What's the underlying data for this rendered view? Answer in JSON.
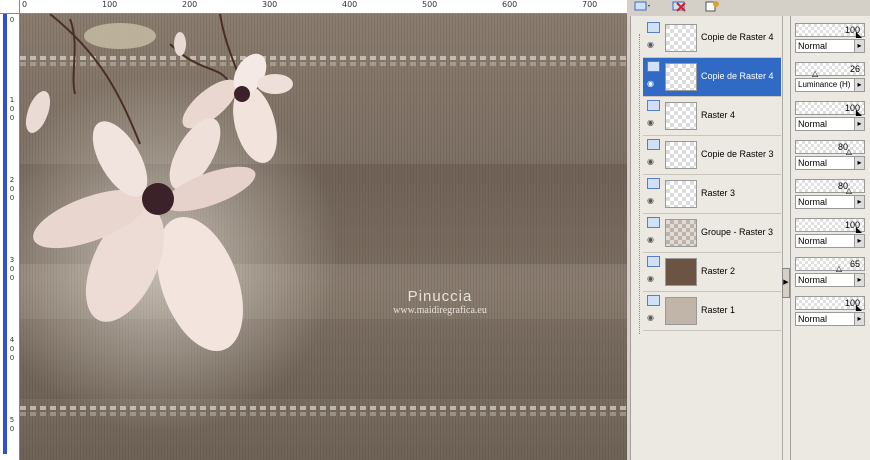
{
  "ruler": {
    "top_labels": [
      "0",
      "100",
      "200",
      "300",
      "400",
      "500",
      "600",
      "700"
    ],
    "left_labels": [
      "0",
      "1\n0\n0",
      "2\n0\n0",
      "3\n0\n0",
      "4\n0\n0",
      "5\n0"
    ]
  },
  "canvas": {
    "watermark_title": "Pinuccia",
    "watermark_url": "www.maidiregrafica.eu"
  },
  "layers": [
    {
      "name": "Copie de Raster 4",
      "selected": false
    },
    {
      "name": "Copie de Raster 4",
      "selected": true
    },
    {
      "name": "Raster 4",
      "selected": false
    },
    {
      "name": "Copie de Raster 3",
      "selected": false
    },
    {
      "name": "Raster 3",
      "selected": false
    },
    {
      "name": "Groupe - Raster 3",
      "selected": false
    },
    {
      "name": "Raster 2",
      "selected": false
    },
    {
      "name": "Raster 1",
      "selected": false
    }
  ],
  "properties": [
    {
      "opacity": "100",
      "blend": "Normal"
    },
    {
      "opacity": "26",
      "blend": "Luminance (H)"
    },
    {
      "opacity": "100",
      "blend": "Normal"
    },
    {
      "opacity": "80",
      "blend": "Normal"
    },
    {
      "opacity": "80",
      "blend": "Normal"
    },
    {
      "opacity": "100",
      "blend": "Normal"
    },
    {
      "opacity": "65",
      "blend": "Normal"
    },
    {
      "opacity": "100",
      "blend": "Normal"
    }
  ],
  "colors": {
    "selection": "#316ac5",
    "panel_bg": "#ece9e2",
    "canvas_bg": "#7d7064"
  }
}
